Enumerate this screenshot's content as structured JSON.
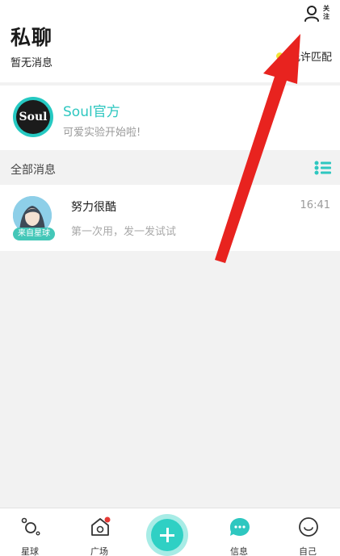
{
  "header": {
    "title": "私聊",
    "subtitle": "暂无消息",
    "follow_label": "关注",
    "match_label": "允许匹配"
  },
  "official": {
    "avatar_text": "Soul",
    "name": "Soul官方",
    "preview": "可爱实验开始啦!"
  },
  "section": {
    "title": "全部消息"
  },
  "chats": [
    {
      "name": "努力很酷",
      "preview": "第一次用，发一发试试",
      "time": "16:41",
      "badge": "来自星球"
    }
  ],
  "nav": {
    "items": [
      {
        "label": "星球",
        "icon": "planet-icon"
      },
      {
        "label": "广场",
        "icon": "square-home-icon"
      },
      {
        "label": "",
        "icon": "plus-icon"
      },
      {
        "label": "信息",
        "icon": "message-icon"
      },
      {
        "label": "自己",
        "icon": "smile-icon"
      }
    ]
  },
  "colors": {
    "accent": "#2ec7c0",
    "arrow": "#e8231f",
    "match_dot": "#f2e43a",
    "notification_dot": "#e53935"
  }
}
